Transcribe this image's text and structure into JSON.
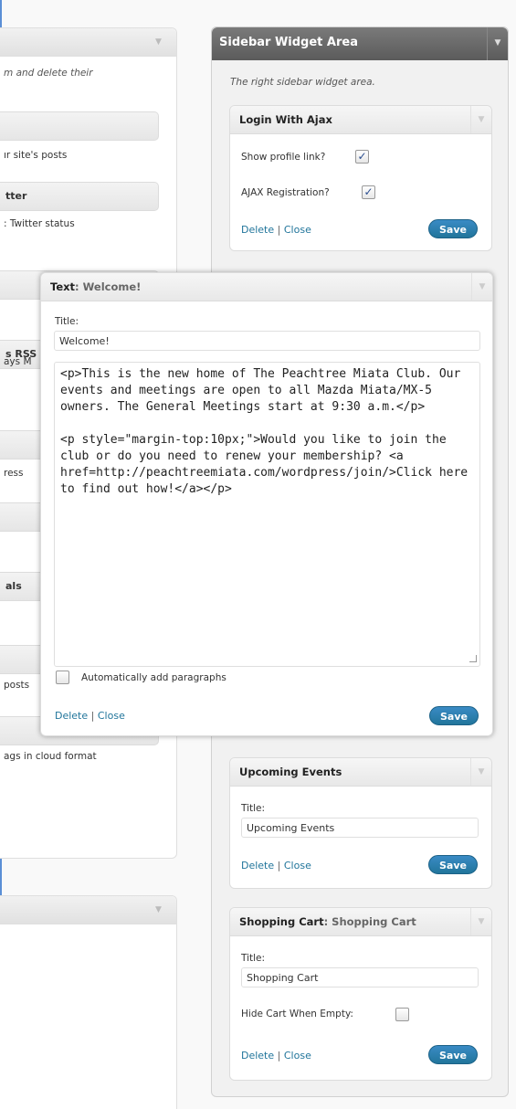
{
  "left_panel": {
    "top_description": "m and delete their",
    "bars": [
      {
        "label": "",
        "desc": "ır site's posts"
      },
      {
        "label": "tter",
        "desc": ": Twitter status"
      },
      {
        "label": ""
      },
      {
        "label": "s RSS",
        "desc": "ays M"
      },
      {
        "label": "",
        "desc": "ress"
      },
      {
        "label": ""
      },
      {
        "label": "als"
      },
      {
        "label": "",
        "desc": "posts"
      },
      {
        "label": "",
        "desc": "ags in cloud format"
      }
    ]
  },
  "sidebar": {
    "title": "Sidebar Widget Area",
    "description": "The right sidebar widget area."
  },
  "widgets": {
    "login": {
      "title": "Login With Ajax",
      "show_profile_label": "Show profile link?",
      "show_profile_checked": "✓",
      "ajax_reg_label": "AJAX Registration?",
      "ajax_reg_checked": "✓",
      "delete": "Delete",
      "sep": "|",
      "close": "Close",
      "save": "Save"
    },
    "text": {
      "title": "Text",
      "subtitle": ": Welcome!",
      "title_label": "Title:",
      "title_value": "Welcome!",
      "content": "<p>This is the new home of The Peachtree Miata Club. Our events and meetings are open to all Mazda Miata/MX-5 owners. The General Meetings start at 9:30 a.m.</p>\n\n<p style=\"margin-top:10px;\">Would you like to join the club or do you need to renew your membership? <a href=http://peachtreemiata.com/wordpress/join/>Click here to find out how!</a></p>",
      "auto_para_label": "Automatically add paragraphs",
      "delete": "Delete",
      "sep": "|",
      "close": "Close",
      "save": "Save"
    },
    "events": {
      "title": "Upcoming Events",
      "title_label": "Title:",
      "title_value": "Upcoming Events",
      "delete": "Delete",
      "sep": "|",
      "close": "Close",
      "save": "Save"
    },
    "cart": {
      "title": "Shopping Cart",
      "subtitle": ": Shopping Cart",
      "title_label": "Title:",
      "title_value": "Shopping Cart",
      "hide_label": "Hide Cart When Empty:",
      "delete": "Delete",
      "sep": "|",
      "close": "Close",
      "save": "Save"
    }
  },
  "icons": {
    "collapse_arrow": "▼"
  }
}
